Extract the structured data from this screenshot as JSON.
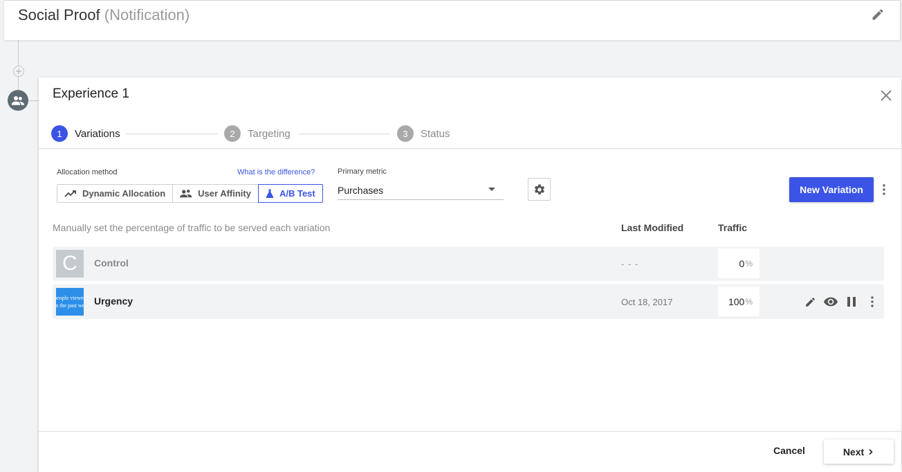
{
  "header": {
    "title": "Social Proof",
    "subtitle": "(Notification)"
  },
  "experience": {
    "title": "Experience 1"
  },
  "steps": [
    {
      "num": "1",
      "label": "Variations"
    },
    {
      "num": "2",
      "label": "Targeting"
    },
    {
      "num": "3",
      "label": "Status"
    }
  ],
  "allocation": {
    "label": "Allocation method",
    "help_link": "What is the difference?",
    "options": [
      "Dynamic Allocation",
      "User Affinity",
      "A/B Test"
    ],
    "selected": "A/B Test"
  },
  "primary_metric": {
    "label": "Primary metric",
    "value": "Purchases"
  },
  "toolbar": {
    "new_variation": "New Variation"
  },
  "table": {
    "instruction": "Manually set the percentage of traffic to be served each variation",
    "col_last_modified": "Last Modified",
    "col_traffic": "Traffic",
    "rows": [
      {
        "thumb": "C",
        "name": "Control",
        "modified": "- - -",
        "traffic": "0",
        "unit": "%"
      },
      {
        "thumb_lines": [
          "people viewed",
          "in the past we"
        ],
        "name": "Urgency",
        "modified": "Oct 18, 2017",
        "traffic": "100",
        "unit": "%"
      }
    ]
  },
  "footer": {
    "cancel": "Cancel",
    "next": "Next"
  },
  "colors": {
    "accent": "#3b54e6",
    "row_bg": "#f1f3f5",
    "thumb_blue": "#2d8fe8"
  }
}
